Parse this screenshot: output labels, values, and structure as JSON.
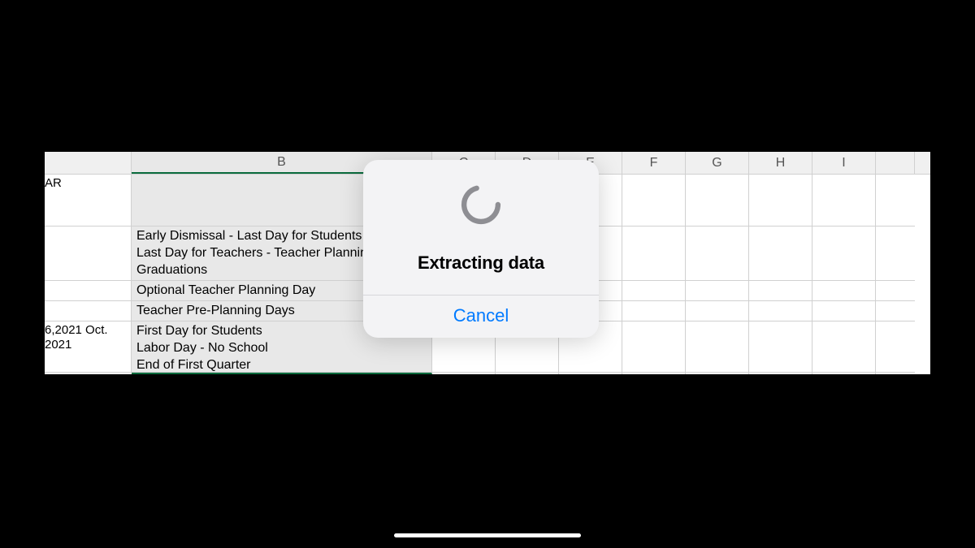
{
  "columns": [
    "B",
    "C",
    "D",
    "E",
    "F",
    "G",
    "H",
    "I",
    ""
  ],
  "rows": {
    "a_partial": "AR",
    "a_date_block": " 6,2021 Oct. 2021",
    "b_block1": "Early Dismissal - Last Day for Students Last Day for Teachers - Teacher Plannir Graduations",
    "b_block1_lines": [
      "Early Dismissal - Last Day for Students",
      "Last Day for Teachers - Teacher Plannir",
      "Graduations"
    ],
    "b_opt": "Optional Teacher Planning Day",
    "b_pre": "Teacher Pre-Planning Days",
    "b_block2_lines": [
      "First Day for Students",
      "Labor Day - No School",
      "End of First Quarter"
    ]
  },
  "dialog": {
    "title": "Extracting data",
    "cancel": "Cancel"
  }
}
